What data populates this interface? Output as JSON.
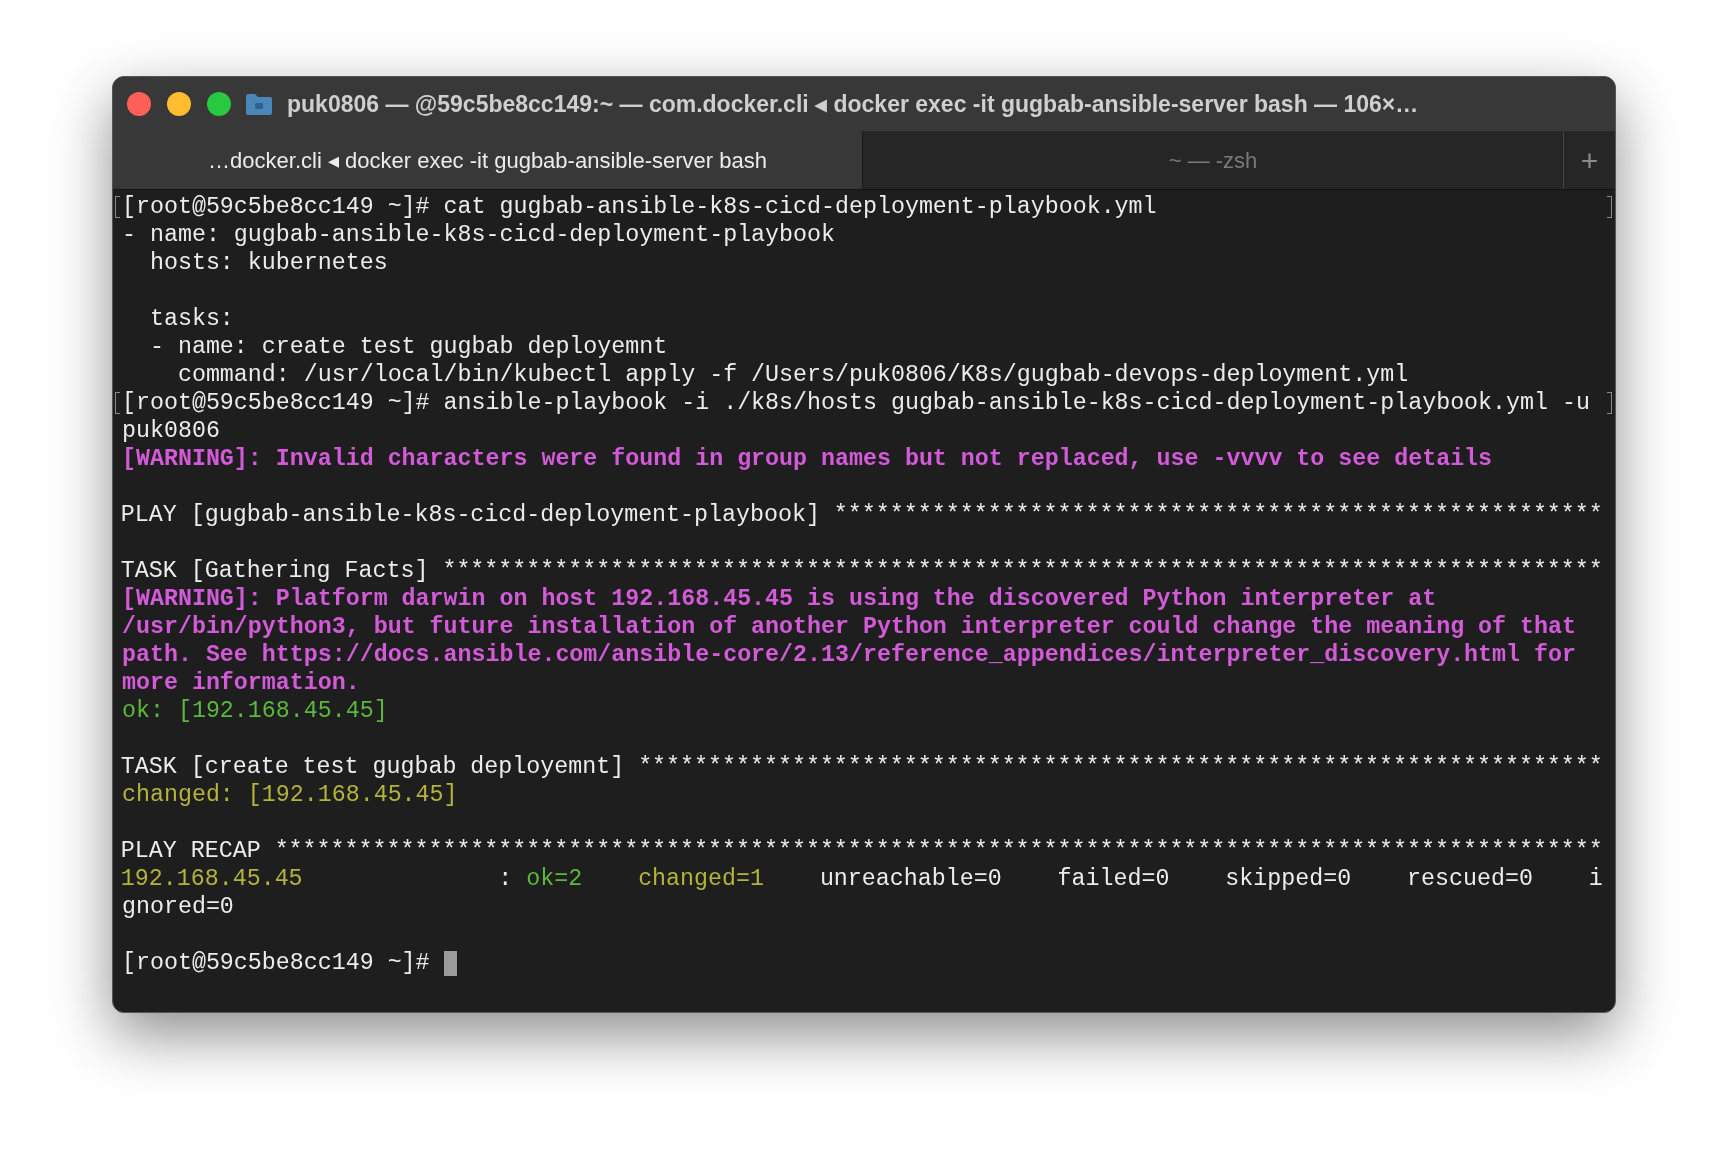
{
  "window": {
    "title": "puk0806 — @59c5be8cc149:~ — com.docker.cli ◂ docker exec -it gugbab-ansible-server bash — 106×…"
  },
  "tabs": [
    {
      "label": "…docker.cli ◂ docker exec -it gugbab-ansible-server bash",
      "selected": true
    },
    {
      "label": "~ — -zsh",
      "selected": false
    }
  ],
  "new_tab": "+",
  "lines": [
    {
      "kind": "plain",
      "marked": true,
      "text": "[root@59c5be8cc149 ~]# cat gugbab-ansible-k8s-cicd-deployment-playbook.yml"
    },
    {
      "kind": "plain",
      "marked": false,
      "text": "- name: gugbab-ansible-k8s-cicd-deployment-playbook"
    },
    {
      "kind": "plain",
      "marked": false,
      "text": "  hosts: kubernetes"
    },
    {
      "kind": "blank",
      "marked": false
    },
    {
      "kind": "plain",
      "marked": false,
      "text": "  tasks:"
    },
    {
      "kind": "plain",
      "marked": false,
      "text": "  - name: create test gugbab deployemnt"
    },
    {
      "kind": "plain",
      "marked": false,
      "text": "    command: /usr/local/bin/kubectl apply -f /Users/puk0806/K8s/gugbab-devops-deployment.yml"
    },
    {
      "kind": "plain",
      "marked": true,
      "text": "[root@59c5be8cc149 ~]# ansible-playbook -i ./k8s/hosts gugbab-ansible-k8s-cicd-deployment-playbook.yml -u"
    },
    {
      "kind": "plain",
      "marked": false,
      "text": "puk0806"
    },
    {
      "kind": "warning",
      "marked": false,
      "text": "[WARNING]: Invalid characters were found in group names but not replaced, use -vvvv to see details"
    },
    {
      "kind": "blank",
      "marked": false
    },
    {
      "kind": "plain",
      "marked": false,
      "text": "PLAY [gugbab-ansible-k8s-cicd-deployment-playbook] *******************************************************"
    },
    {
      "kind": "blank",
      "marked": false
    },
    {
      "kind": "plain",
      "marked": false,
      "text": "TASK [Gathering Facts] ***********************************************************************************"
    },
    {
      "kind": "warning",
      "marked": false,
      "text": "[WARNING]: Platform darwin on host 192.168.45.45 is using the discovered Python interpreter at"
    },
    {
      "kind": "warning",
      "marked": false,
      "text": "/usr/bin/python3, but future installation of another Python interpreter could change the meaning of that"
    },
    {
      "kind": "warning",
      "marked": false,
      "text": "path. See https://docs.ansible.com/ansible-core/2.13/reference_appendices/interpreter_discovery.html for"
    },
    {
      "kind": "warning",
      "marked": false,
      "text": "more information."
    },
    {
      "kind": "ok",
      "marked": false,
      "text": "ok: [192.168.45.45]"
    },
    {
      "kind": "blank",
      "marked": false
    },
    {
      "kind": "plain",
      "marked": false,
      "text": "TASK [create test gugbab deployemnt] *********************************************************************"
    },
    {
      "kind": "changed",
      "marked": false,
      "text": "changed: [192.168.45.45]"
    },
    {
      "kind": "blank",
      "marked": false
    },
    {
      "kind": "plain",
      "marked": false,
      "text": "PLAY RECAP ***********************************************************************************************"
    },
    {
      "kind": "recap",
      "marked": false,
      "segments": [
        {
          "kind": "changed",
          "text": "192.168.45.45"
        },
        {
          "kind": "plain",
          "text": "              : "
        },
        {
          "kind": "ok",
          "text": "ok=2    "
        },
        {
          "kind": "changed",
          "text": "changed=1"
        },
        {
          "kind": "plain",
          "text": "    unreachable=0    failed=0    skipped=0    rescued=0    i"
        }
      ]
    },
    {
      "kind": "plain",
      "marked": false,
      "text": "gnored=0"
    },
    {
      "kind": "blank",
      "marked": false
    },
    {
      "kind": "prompt",
      "marked": false,
      "cursor": true,
      "text": "[root@59c5be8cc149 ~]# "
    }
  ]
}
